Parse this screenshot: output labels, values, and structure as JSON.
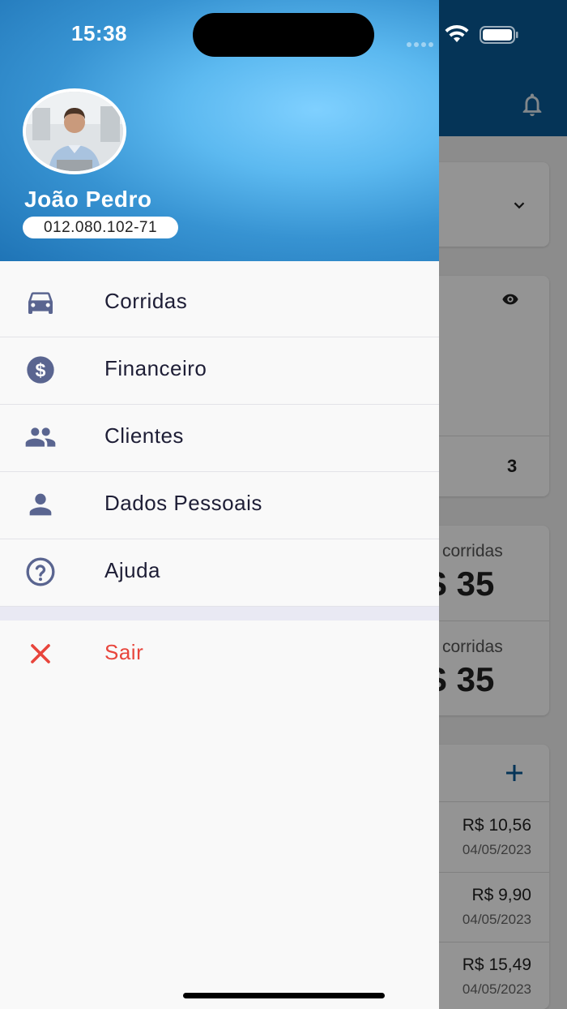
{
  "status_bar": {
    "time": "15:38"
  },
  "user": {
    "name": "João Pedro",
    "cpf": "012.080.102-71"
  },
  "menu": {
    "items": [
      {
        "label": "Corridas",
        "icon": "car-icon"
      },
      {
        "label": "Financeiro",
        "icon": "dollar-icon"
      },
      {
        "label": "Clientes",
        "icon": "people-icon"
      },
      {
        "label": "Dados Pessoais",
        "icon": "person-icon"
      },
      {
        "label": "Ajuda",
        "icon": "help-icon"
      }
    ],
    "logout": {
      "label": "Sair",
      "icon": "close-icon"
    }
  },
  "background": {
    "count_value": "3",
    "stat1": {
      "label": "corridas",
      "value": "S 35"
    },
    "stat2": {
      "label": "corridas",
      "value": "S 35"
    },
    "transactions": [
      {
        "amount": "R$ 10,56",
        "date": "04/05/2023"
      },
      {
        "amount": "R$ 9,90",
        "date": "04/05/2023"
      },
      {
        "amount": "R$ 15,49",
        "date": "04/05/2023"
      }
    ]
  },
  "colors": {
    "accent": "#0a5a97",
    "danger": "#e8453c",
    "icon": "#5a6590"
  }
}
